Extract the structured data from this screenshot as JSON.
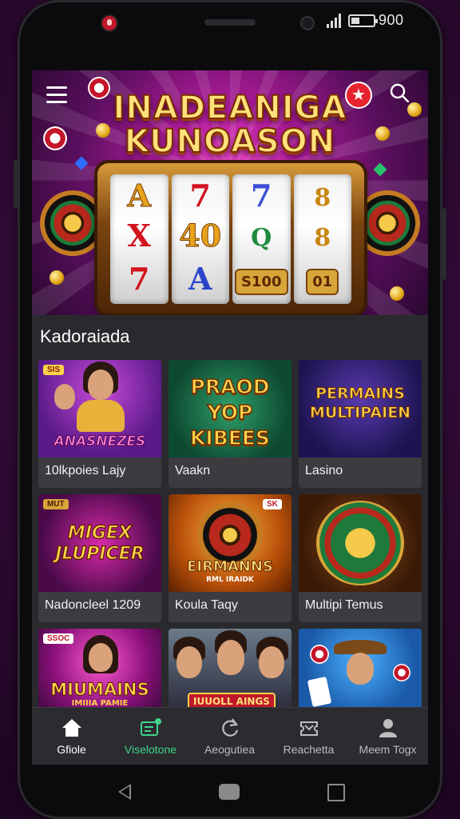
{
  "status_bar": {
    "time": "900"
  },
  "hero": {
    "title_line1": "INADEANIGA",
    "title_line2": "KUNOASON",
    "reels": [
      [
        "A",
        "X",
        "7"
      ],
      [
        "7",
        "40",
        "A"
      ],
      [
        "7",
        "Q",
        "S100"
      ],
      [
        "8",
        "8",
        "01"
      ]
    ]
  },
  "section": {
    "title": "Kadoraiada"
  },
  "games": [
    {
      "label": "10lkpoies Lajy",
      "art_text": "ANASNEZES",
      "badge": "SIS"
    },
    {
      "label": "Vaakn",
      "art_text": "PRAOD YOP KIBEES",
      "badge": ""
    },
    {
      "label": "Lasino",
      "art_text": "PERMAINS MULTIPAIEN",
      "badge": ""
    },
    {
      "label": "Nadoncleel 1209",
      "art_text": "MIGEX JLUPICER",
      "badge": "MUT"
    },
    {
      "label": "Koula Taqy",
      "art_text": "EIRMANNS",
      "art_sub": "RML IRAIDK",
      "badge": "SK"
    },
    {
      "label": "Multipi Temus",
      "art_text": "",
      "badge": ""
    },
    {
      "label": "",
      "art_text": "MIUMAINS",
      "art_sub": "IMIIIA PAMIE",
      "badge": "SSOC"
    },
    {
      "label": "",
      "art_text": "IUUOLL AINGS",
      "badge": ""
    },
    {
      "label": "",
      "art_text": "",
      "badge": ""
    }
  ],
  "bottom_nav": [
    {
      "label": "Gfiole",
      "icon": "home-icon",
      "active": true
    },
    {
      "label": "Viselotone",
      "icon": "chat-icon",
      "active": false
    },
    {
      "label": "Aeogutiea",
      "icon": "refresh-icon",
      "active": false
    },
    {
      "label": "Reachetta",
      "icon": "ticket-icon",
      "active": false
    },
    {
      "label": "Meem Togx",
      "icon": "profile-icon",
      "active": false
    }
  ],
  "colors": {
    "accent_green": "#3fd58a",
    "hero_magenta": "#b21c9c",
    "card_bg": "#3b3b40"
  }
}
